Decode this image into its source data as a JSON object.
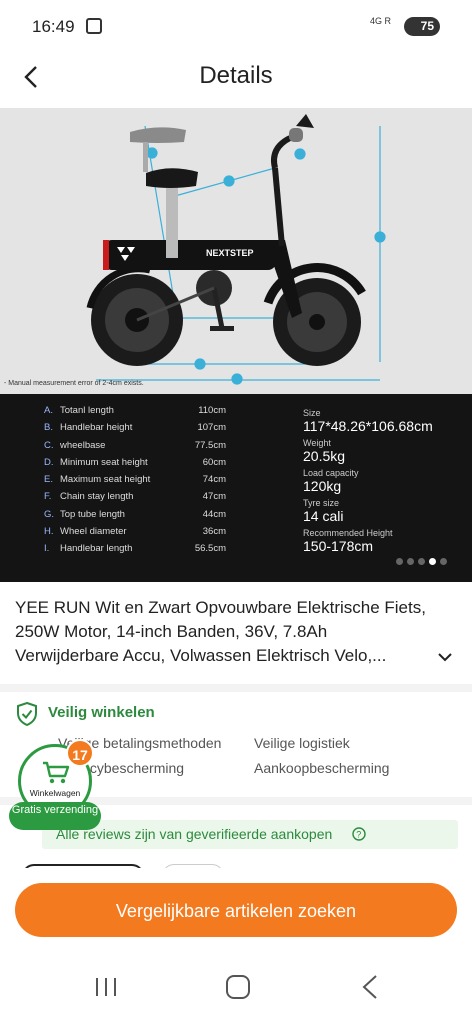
{
  "status": {
    "time": "16:49",
    "signal": "4G R",
    "battery": "75"
  },
  "header": {
    "title": "Details"
  },
  "hero": {
    "warning": "- Manual measurement error of 2-4cm exists.",
    "brand": "NEXTSTEP",
    "diagram_markers": [
      "A",
      "B",
      "C",
      "D",
      "E",
      "F",
      "G",
      "H",
      "I"
    ],
    "specs": [
      {
        "key": "A.",
        "label": "Totanl length",
        "value": "110cm"
      },
      {
        "key": "B.",
        "label": "Handlebar height",
        "value": "107cm"
      },
      {
        "key": "C.",
        "label": "wheelbase",
        "value": "77.5cm"
      },
      {
        "key": "D.",
        "label": "Minimum seat height",
        "value": "60cm"
      },
      {
        "key": "E.",
        "label": "Maximum seat height",
        "value": "74cm"
      },
      {
        "key": "F.",
        "label": "Chain stay length",
        "value": "47cm"
      },
      {
        "key": "G.",
        "label": "Top tube length",
        "value": "44cm"
      },
      {
        "key": "H.",
        "label": "Wheel diameter",
        "value": "36cm"
      },
      {
        "key": "I.",
        "label": "Handlebar length",
        "value": "56.5cm"
      }
    ],
    "right_specs": [
      {
        "label": "Size",
        "value": "117*48.26*106.68cm"
      },
      {
        "label": "Weight",
        "value": "20.5kg"
      },
      {
        "label": "Load capacity",
        "value": "120kg"
      },
      {
        "label": "Tyre size",
        "value": "14 cali"
      },
      {
        "label": "Recommended Height",
        "value": "150-178cm"
      }
    ],
    "carousel_count": 5,
    "carousel_active": 3
  },
  "product": {
    "title": "YEE RUN Wit en Zwart Opvouwbare Elektrische Fiets, 250W Motor, 14-inch Banden, 36V, 7.8Ah Verwijderbare Accu, Volwassen Elektrisch Velo,..."
  },
  "safe": {
    "title": "Veilig winkelen",
    "items": [
      "Veilige betalingsmethoden",
      "Veilige logistiek",
      "Privacybescherming",
      "Aankoopbescherming"
    ]
  },
  "reviews": {
    "text": "Alle reviews zijn van geverifieerde aankopen"
  },
  "cart": {
    "count": "17",
    "label": "Winkelwagen",
    "shipping": "Gratis verzending"
  },
  "cta": {
    "label": "Vergelijkbare artikelen zoeken"
  },
  "colors": {
    "accent": "#f47a1f",
    "green": "#2c9a40",
    "measure": "#3ab0d8"
  }
}
